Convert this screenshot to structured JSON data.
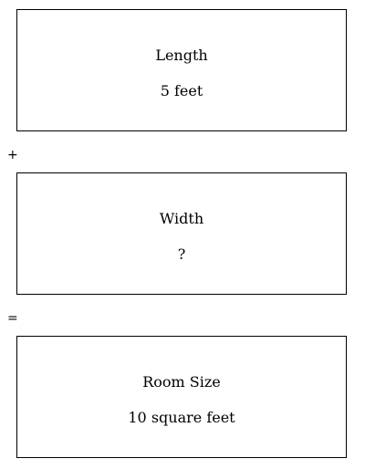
{
  "boxes": {
    "length": {
      "label": "Length",
      "value": "5 feet"
    },
    "width": {
      "label": "Width",
      "value": "?"
    },
    "room": {
      "label": "Room Size",
      "value": "10 square feet"
    }
  },
  "operators": {
    "plus": "+",
    "equals": "="
  }
}
